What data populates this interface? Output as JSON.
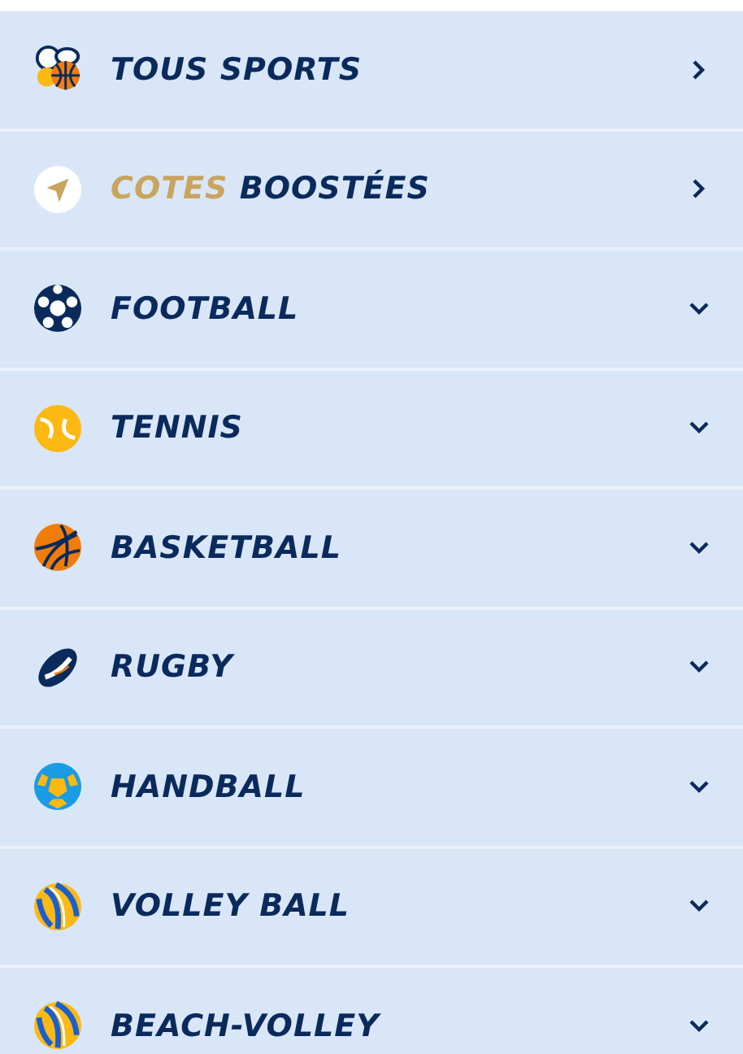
{
  "menu": [
    {
      "kind": "all",
      "label": "TOUS SPORTS",
      "expandable": false
    },
    {
      "kind": "boost",
      "highlight": "COTES",
      "label": "BOOSTÉES",
      "expandable": false
    },
    {
      "kind": "football",
      "label": "FOOTBALL",
      "expandable": true
    },
    {
      "kind": "tennis",
      "label": "TENNIS",
      "expandable": true
    },
    {
      "kind": "basketball",
      "label": "BASKETBALL",
      "expandable": true
    },
    {
      "kind": "rugby",
      "label": "RUGBY",
      "expandable": true
    },
    {
      "kind": "handball",
      "label": "HANDBALL",
      "expandable": true
    },
    {
      "kind": "volleyball",
      "label": "VOLLEY BALL",
      "expandable": true
    },
    {
      "kind": "volleyball",
      "label": "BEACH-VOLLEY",
      "expandable": true
    }
  ]
}
